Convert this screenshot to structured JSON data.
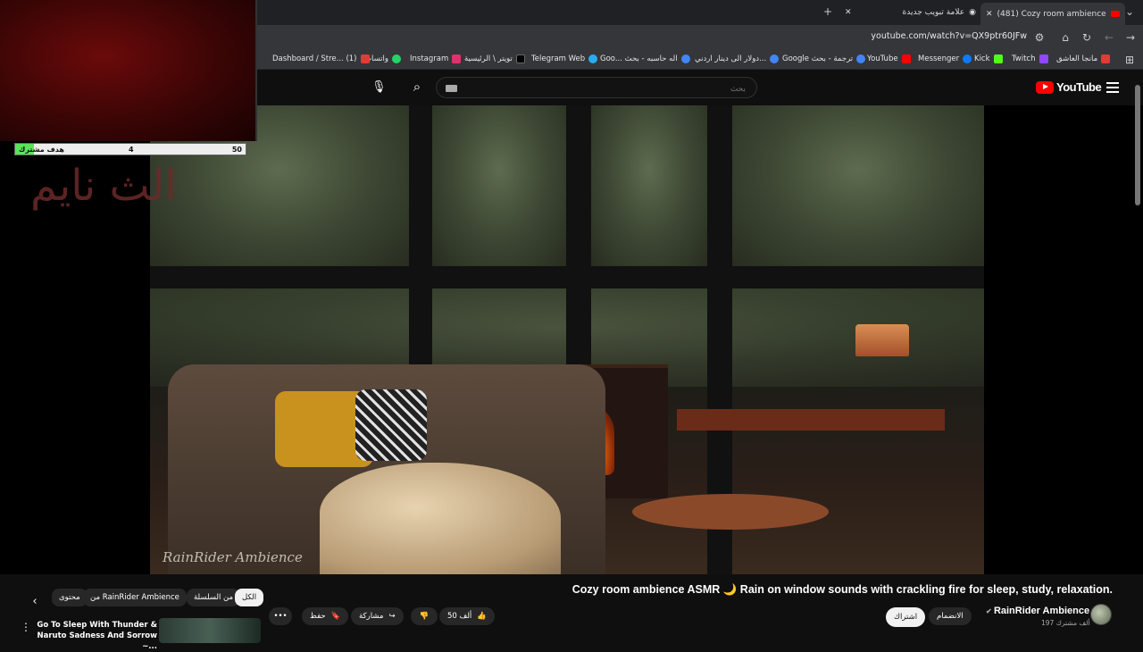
{
  "browser": {
    "tabs": [
      {
        "label": "(481) Cozy room ambience",
        "active": true
      },
      {
        "label": "علامة تبويب جديدة",
        "active": false
      }
    ],
    "url": "youtube.com/watch?v=QX9ptr60JFw",
    "bookmarks": [
      {
        "label": "مانجا العاشق",
        "color": "#e53935"
      },
      {
        "label": "Twitch",
        "color": "#9146ff"
      },
      {
        "label": "Kick",
        "color": "#53fc18"
      },
      {
        "label": "Messenger",
        "color": "#0a7cff"
      },
      {
        "label": "YouTube",
        "color": "#ff0000"
      },
      {
        "label": "Google ترجمة - بحث",
        "color": "#4285f4"
      },
      {
        "label": "دولار الى دينار اردني...",
        "color": "#4285f4"
      },
      {
        "label": "Goo... اله حاسبه - بحث",
        "color": "#4285f4"
      },
      {
        "label": "Telegram Web",
        "color": "#2aabee"
      },
      {
        "label": "تويتر \\ الرئيسية",
        "color": "#000000"
      },
      {
        "label": "Instagram",
        "color": "#e1306c"
      },
      {
        "label": "واتساب",
        "color": "#25d366"
      },
      {
        "label": "Dashboard / Stre... (1)",
        "color": "#e53935"
      }
    ]
  },
  "youtube": {
    "logo_text": "YouTube",
    "search_placeholder": "بحث"
  },
  "overlay": {
    "goal_label": "هدف مشترك",
    "goal_current": "4",
    "goal_target": "50",
    "goal_progress": 0.08,
    "overlay_text": "الث نايم"
  },
  "video": {
    "watermark": "RainRider Ambience",
    "title": "Cozy room ambience ASMR 🌙 Rain on window sounds with crackling fire for sleep, study, relaxation."
  },
  "channel": {
    "name": "RainRider Ambience",
    "subscribers": "197 ألف مشترك",
    "join_label": "الانضمام",
    "subscribe_label": "اشتراك"
  },
  "actions": {
    "likes": "50 ألف",
    "share_label": "مشاركة",
    "save_label": "حفظ"
  },
  "chips": {
    "all": "الكل",
    "from_series": "من السلسلة",
    "from_channel": "من RainRider Ambience",
    "related": "محتوى"
  },
  "related": {
    "title": "Go To Sleep With Thunder & Naruto Sadness And Sorrow ~..."
  }
}
